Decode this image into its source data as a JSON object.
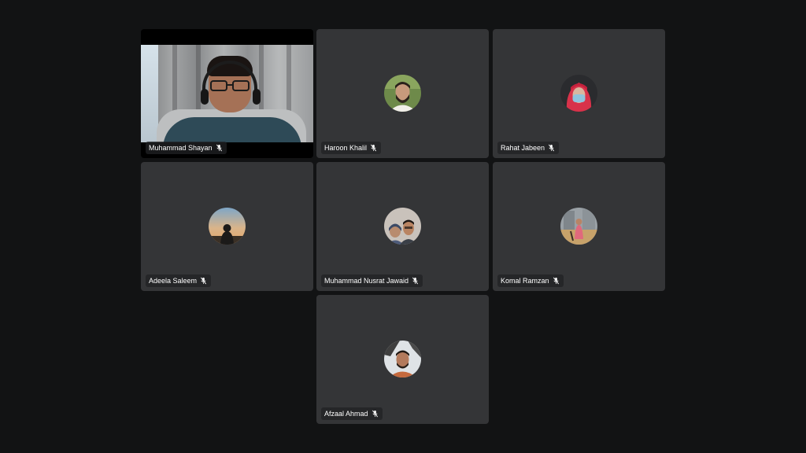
{
  "participants": [
    {
      "name": "Muhammad Shayan",
      "video": true,
      "muted": true,
      "mic_icon": "mic-off-icon"
    },
    {
      "name": "Haroon Khalil",
      "video": false,
      "muted": true,
      "mic_icon": "mic-off-icon",
      "avatar_icon": "profile-photo"
    },
    {
      "name": "Rahat Jabeen",
      "video": false,
      "muted": true,
      "mic_icon": "mic-off-icon",
      "avatar_icon": "profile-photo"
    },
    {
      "name": "Adeela Saleem",
      "video": false,
      "muted": true,
      "mic_icon": "mic-off-icon",
      "avatar_icon": "profile-photo"
    },
    {
      "name": "Muhammad Nusrat Jawaid",
      "video": false,
      "muted": true,
      "mic_icon": "mic-off-icon",
      "avatar_icon": "profile-photo"
    },
    {
      "name": "Komal Ramzan",
      "video": false,
      "muted": true,
      "mic_icon": "mic-off-icon",
      "avatar_icon": "profile-photo"
    },
    {
      "name": "Afzaal Ahmad",
      "video": false,
      "muted": true,
      "mic_icon": "mic-off-icon",
      "avatar_icon": "profile-photo"
    }
  ],
  "colors": {
    "background": "#121314",
    "tile": "#343537",
    "name_tag": "#202124",
    "text": "#ffffff"
  }
}
